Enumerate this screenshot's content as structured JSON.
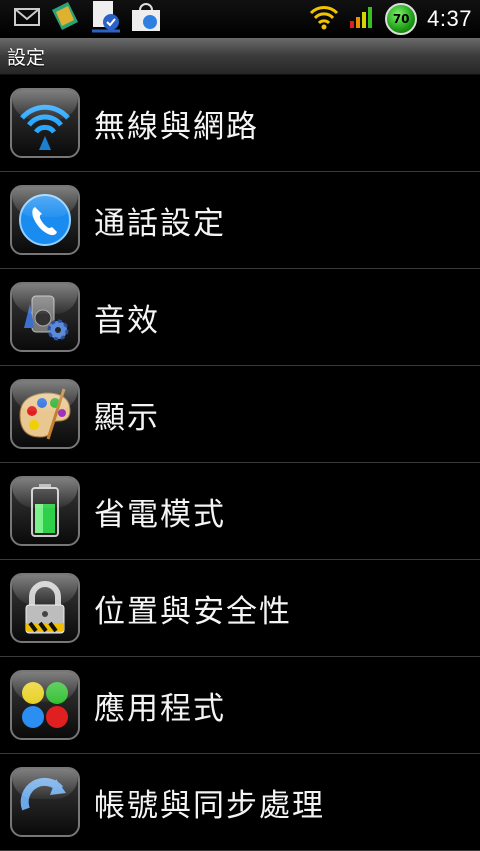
{
  "status_bar": {
    "time": "4:37",
    "battery_level": "70",
    "icons": [
      "gmail-icon",
      "app-notification-icon",
      "download-complete-icon",
      "market-update-icon",
      "wifi-icon",
      "signal-icon",
      "battery-icon"
    ]
  },
  "title": "設定",
  "menu": [
    {
      "label": "無線與網路",
      "icon": "wireless-icon"
    },
    {
      "label": "通話設定",
      "icon": "phone-icon"
    },
    {
      "label": "音效",
      "icon": "sound-icon"
    },
    {
      "label": "顯示",
      "icon": "palette-icon"
    },
    {
      "label": "省電模式",
      "icon": "battery-saver-icon"
    },
    {
      "label": "位置與安全性",
      "icon": "lock-icon"
    },
    {
      "label": "應用程式",
      "icon": "applications-icon"
    },
    {
      "label": "帳號與同步處理",
      "icon": "sync-icon"
    }
  ],
  "colors": {
    "accent": "#1a9cff",
    "background": "#000000",
    "divider": "#3a3a3a"
  }
}
